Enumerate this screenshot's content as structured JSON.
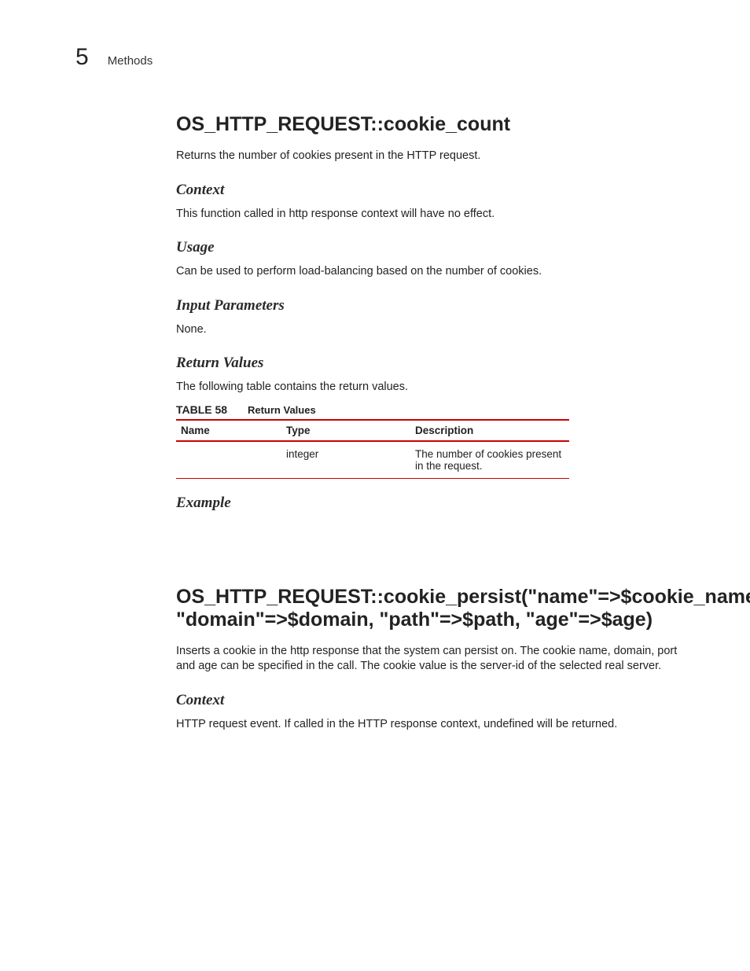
{
  "header": {
    "chapter_number": "5",
    "running_title": "Methods"
  },
  "section1": {
    "title": "OS_HTTP_REQUEST::cookie_count",
    "intro": "Returns the number of cookies present in the HTTP request.",
    "context_h": "Context",
    "context_p": "This function called in http response context will have no effect.",
    "usage_h": "Usage",
    "usage_p": "Can be used to perform load-balancing based on the number of cookies.",
    "input_h": "Input Parameters",
    "input_p": "None.",
    "return_h": "Return Values",
    "return_p": "The following table contains the return values.",
    "table": {
      "label": "TABLE 58",
      "title": "Return Values",
      "headers": {
        "c0": "Name",
        "c1": "Type",
        "c2": "Description"
      },
      "row0": {
        "name": "",
        "type": "integer",
        "desc": "The number of cookies present in the request."
      }
    },
    "example_h": "Example"
  },
  "section2": {
    "title": "OS_HTTP_REQUEST::cookie_persist(\"name\"=>$cookie_name, \"domain\"=>$domain, \"path\"=>$path, \"age\"=>$age)",
    "intro": "Inserts a cookie in the http response that the system can persist on. The cookie name, domain, port and age can be specified in the call. The cookie value is the server-id of the selected real server.",
    "context_h": "Context",
    "context_p": "HTTP request event. If called in the HTTP response context, undefined will be returned."
  }
}
